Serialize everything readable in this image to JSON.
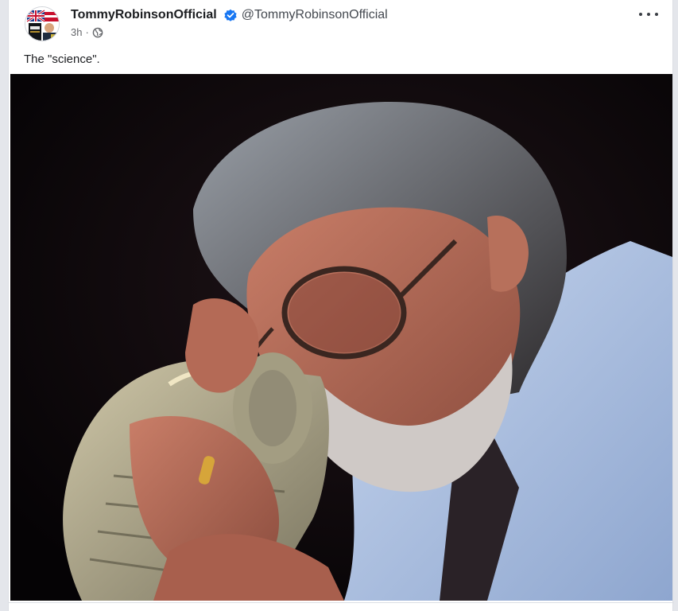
{
  "post": {
    "author": {
      "display_name": "TommyRobinsonOfficial",
      "handle": "@TommyRobinsonOfficial",
      "verified": true,
      "avatar_icon": "avatar-flag-collage"
    },
    "timestamp": "3h",
    "separator": "·",
    "audience_icon": "globe-icon",
    "more_icon": "more-options-icon",
    "text": "The \"science\".",
    "image": {
      "icon": "photo-man-glasses-kissing-money-stack"
    }
  },
  "colors": {
    "verified_blue": "#1877f2",
    "text_primary": "#1c1e21",
    "text_secondary": "#65676b",
    "image_background": "#060406"
  }
}
